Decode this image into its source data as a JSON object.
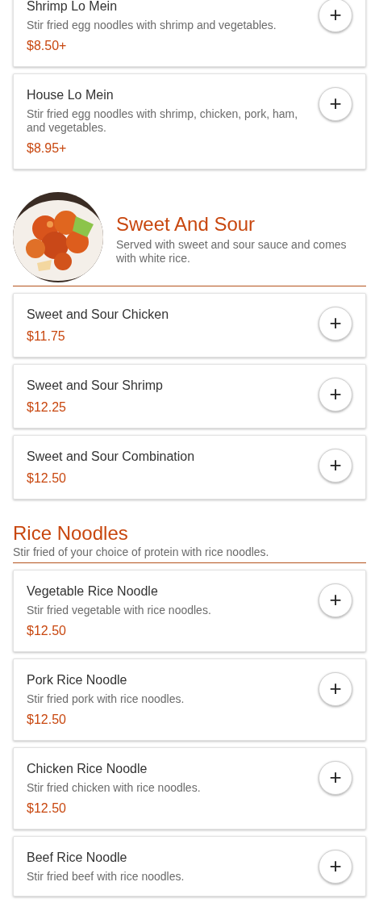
{
  "sections": [
    {
      "items": [
        {
          "name": "Shrimp Lo Mein",
          "description": "Stir fried egg noodles with shrimp and vegetables.",
          "price": "$8.50+",
          "button": "+"
        },
        {
          "name": "House Lo Mein",
          "description": "Stir fried egg noodles with shrimp, chicken, pork, ham, and vegetables.",
          "price": "$8.95+",
          "button": "+"
        }
      ]
    },
    {
      "title": "Sweet And Sour",
      "description": "Served with sweet and sour sauce and comes with white rice.",
      "image": {
        "kind": "picture"
      },
      "items": [
        {
          "name": "Sweet and Sour Chicken",
          "price": "$11.75",
          "button": "+"
        },
        {
          "name": "Sweet and Sour Shrimp",
          "price": "$12.25",
          "button": "+"
        },
        {
          "name": "Sweet and Sour Combination",
          "price": "$12.50",
          "button": "+"
        }
      ]
    },
    {
      "title": "Rice Noodles",
      "description": "Stir fried of your choice of protein with rice noodles.",
      "items": [
        {
          "name": "Vegetable Rice Noodle",
          "description": "Stir fried vegetable with rice noodles.",
          "price": "$12.50",
          "button": "+"
        },
        {
          "name": "Pork Rice Noodle",
          "description": "Stir fried pork with rice noodles.",
          "price": "$12.50",
          "button": "+"
        },
        {
          "name": "Chicken Rice Noodle",
          "description": "Stir fried chicken with rice noodles.",
          "price": "$12.50",
          "button": "+"
        },
        {
          "name": "Beef Rice Noodle",
          "description": "Stir fried beef with rice noodles.",
          "button": "+"
        }
      ]
    }
  ]
}
